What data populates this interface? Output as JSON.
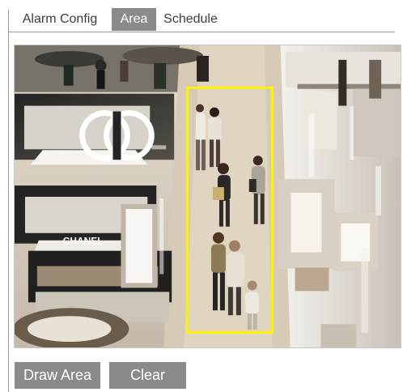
{
  "tabs": [
    {
      "label": "Alarm Config",
      "active": false
    },
    {
      "label": "Area",
      "active": true
    },
    {
      "label": "Schedule",
      "active": false
    }
  ],
  "preview": {
    "store_sign": "CHANEL"
  },
  "buttons": {
    "draw_area": "Draw Area",
    "clear": "Clear"
  },
  "colors": {
    "active_tab": "#8a8a8a",
    "detection_box": "#fff200",
    "button_bg": "#8a8a8a",
    "border": "#9a9a9a"
  }
}
